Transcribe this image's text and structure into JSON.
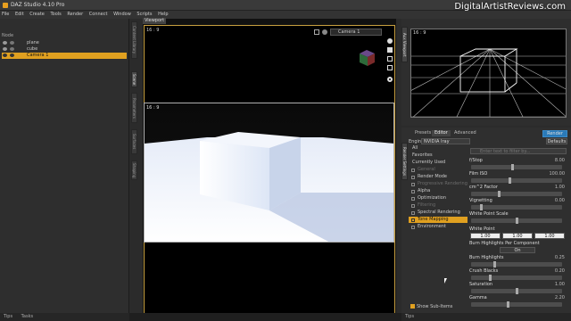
{
  "app": {
    "title": "DAZ Studio 4.10 Pro"
  },
  "watermark": "DigitalArtistReviews.com",
  "menu": [
    "File",
    "Edit",
    "Create",
    "Tools",
    "Render",
    "Connect",
    "Window",
    "Scripts",
    "Help"
  ],
  "scene": {
    "header": "Node",
    "items": [
      {
        "label": "plane",
        "selected": false
      },
      {
        "label": "cube",
        "selected": false
      },
      {
        "label": "Camera 1",
        "selected": true
      }
    ],
    "tabs": [
      "Content Library",
      "Scene",
      "Parameters",
      "Surfaces",
      "Shaping"
    ]
  },
  "viewport": {
    "tab": "Viewport",
    "camera": "Camera 1",
    "aspect_top": "16 : 9",
    "aspect_render": "16 : 9"
  },
  "aux": {
    "aspect": "16 : 9",
    "side_tab": "Aux Viewport"
  },
  "render_settings": {
    "tabs": [
      "Presets",
      "Editor",
      "Advanced"
    ],
    "active_tab": "Editor",
    "render_button": "Render",
    "engine_label": "Engine",
    "engine_value": "NVIDIA Iray",
    "defaults_button": "Defaults",
    "side_tab": "Render Settings",
    "categories": [
      {
        "label": "All",
        "state": "normal"
      },
      {
        "label": "Favorites",
        "state": "normal"
      },
      {
        "label": "Currently Used",
        "state": "normal"
      },
      {
        "label": "General",
        "state": "dim"
      },
      {
        "label": "Render Mode",
        "state": "normal"
      },
      {
        "label": "Progressive Rendering",
        "state": "dim"
      },
      {
        "label": "Alpha",
        "state": "normal"
      },
      {
        "label": "Optimization",
        "state": "normal"
      },
      {
        "label": "Filtering",
        "state": "dim"
      },
      {
        "label": "Spectral Rendering",
        "state": "normal"
      },
      {
        "label": "Tone Mapping",
        "state": "highlight"
      },
      {
        "label": "Environment",
        "state": "normal"
      }
    ],
    "filter_placeholder": "Enter text to filter by...",
    "properties": [
      {
        "label": "f/Stop",
        "value": "8.00",
        "knob": 0.45
      },
      {
        "label": "Film ISO",
        "value": "100.00",
        "knob": 0.42
      },
      {
        "label": "cm^2 Factor",
        "value": "1.00",
        "knob": 0.3
      },
      {
        "label": "Vignetting",
        "value": "0.00",
        "knob": 0.1
      },
      {
        "label": "White Point Scale",
        "value": "",
        "knob": 0.5
      }
    ],
    "white_point": {
      "label": "White Point",
      "values": [
        "1.00",
        "1.00",
        "1.00"
      ]
    },
    "burn_per_component": {
      "label": "Burn Highlights Per Component",
      "value": "On"
    },
    "lower_properties": [
      {
        "label": "Burn Highlights",
        "value": "0.25",
        "knob": 0.25
      },
      {
        "label": "Crush Blacks",
        "value": "0.20",
        "knob": 0.2
      },
      {
        "label": "Saturation",
        "value": "1.00",
        "knob": 0.5
      },
      {
        "label": "Gamma",
        "value": "2.20",
        "knob": 0.4
      }
    ],
    "show_subitems": "Show Sub-Items"
  },
  "status": {
    "left": [
      "Tips",
      "Tasks"
    ],
    "right": [
      "Tips"
    ]
  }
}
